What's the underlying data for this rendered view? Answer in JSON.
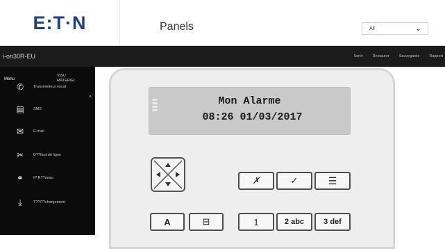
{
  "header": {
    "logo": "E:T·N",
    "title": "Panels",
    "filter": {
      "value": "All"
    }
  },
  "topbar": {
    "device": "i-on30R-EU",
    "actions": [
      "Sortir",
      "Restaurer",
      "Sauvegarde",
      "Rapport"
    ]
  },
  "sidebar": {
    "tab_menu": "Menu",
    "tab_visu": "VISU MATERIEL",
    "items": [
      {
        "icon": "phone-icon",
        "label": "Transmetteur vocal"
      },
      {
        "icon": "sms-icon",
        "label": "SMS"
      },
      {
        "icon": "email-icon",
        "label": "E-mail"
      },
      {
        "icon": "line-fault-icon",
        "label": "D??faut de ligne"
      },
      {
        "icon": "network-icon",
        "label": "IP R??seau"
      },
      {
        "icon": "download-icon",
        "label": "T??l??chargement"
      }
    ]
  },
  "lcd": {
    "line1": "Mon Alarme",
    "line2": "08:26 01/03/2017"
  },
  "keys": {
    "cancel": "✗",
    "ok": "✓",
    "menu": "☰",
    "a": "A",
    "lock": "⊟",
    "one": "1",
    "two": "2 abc",
    "three": "3 def"
  }
}
